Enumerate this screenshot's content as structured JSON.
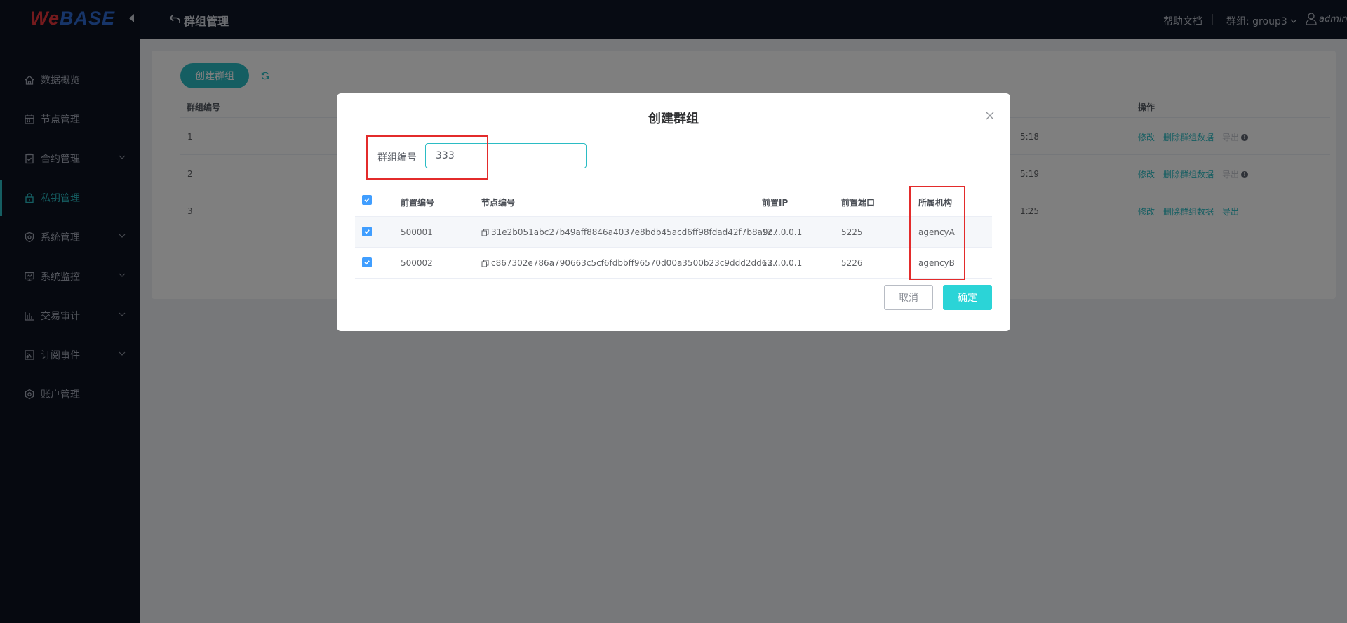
{
  "app": {
    "logo_we": "We",
    "logo_base": "BASE"
  },
  "sidebar": {
    "items": [
      {
        "label": "数据概览",
        "icon": "home-icon"
      },
      {
        "label": "节点管理",
        "icon": "calendar-icon"
      },
      {
        "label": "合约管理",
        "icon": "clipboard-icon"
      },
      {
        "label": "私钥管理",
        "icon": "lock-icon"
      },
      {
        "label": "系统管理",
        "icon": "shield-icon"
      },
      {
        "label": "系统监控",
        "icon": "monitor-icon"
      },
      {
        "label": "交易审计",
        "icon": "bar-chart-icon"
      },
      {
        "label": "订阅事件",
        "icon": "rss-icon"
      },
      {
        "label": "账户管理",
        "icon": "settings-icon"
      }
    ],
    "active_index": 3
  },
  "header": {
    "title": "群组管理",
    "help": "帮助文档",
    "group": "群组: group3",
    "user": "admin"
  },
  "page": {
    "create_button": "创建群组",
    "table_headers": {
      "id": "群组编号",
      "ops": "操作"
    },
    "rows": [
      {
        "id": "1",
        "time": "5:18",
        "edit": "修改",
        "delete": "删除群组数据",
        "export": "导出",
        "export_enabled": false
      },
      {
        "id": "2",
        "time": "5:19",
        "edit": "修改",
        "delete": "删除群组数据",
        "export": "导出",
        "export_enabled": false
      },
      {
        "id": "3",
        "time": "1:25",
        "edit": "修改",
        "delete": "删除群组数据",
        "export": "导出",
        "export_enabled": true
      }
    ]
  },
  "dialog": {
    "title": "创建群组",
    "group_id_label": "群组编号",
    "group_id_value": "333",
    "columns": {
      "front_id": "前置编号",
      "node_id": "节点编号",
      "ip": "前置IP",
      "port": "前置端口",
      "agency": "所属机构"
    },
    "rows": [
      {
        "front_id": "500001",
        "node_id": "31e2b051abc27b49aff8846a4037e8bdb45acd6ff98fdad42f7b8a9c...",
        "ip": "127.0.0.1",
        "port": "5225",
        "agency": "agencyA",
        "checked": true
      },
      {
        "front_id": "500002",
        "node_id": "c867302e786a790663c5cf6fdbbff96570d00a3500b23c9ddd2dd63...",
        "ip": "127.0.0.1",
        "port": "5226",
        "agency": "agencyB",
        "checked": true
      }
    ],
    "cancel": "取消",
    "confirm": "确定"
  },
  "colors": {
    "accent": "#2bbcc4",
    "highlight": "#e32b2b",
    "checkbox": "#409eff",
    "sidebar_bg": "#0c1220"
  }
}
